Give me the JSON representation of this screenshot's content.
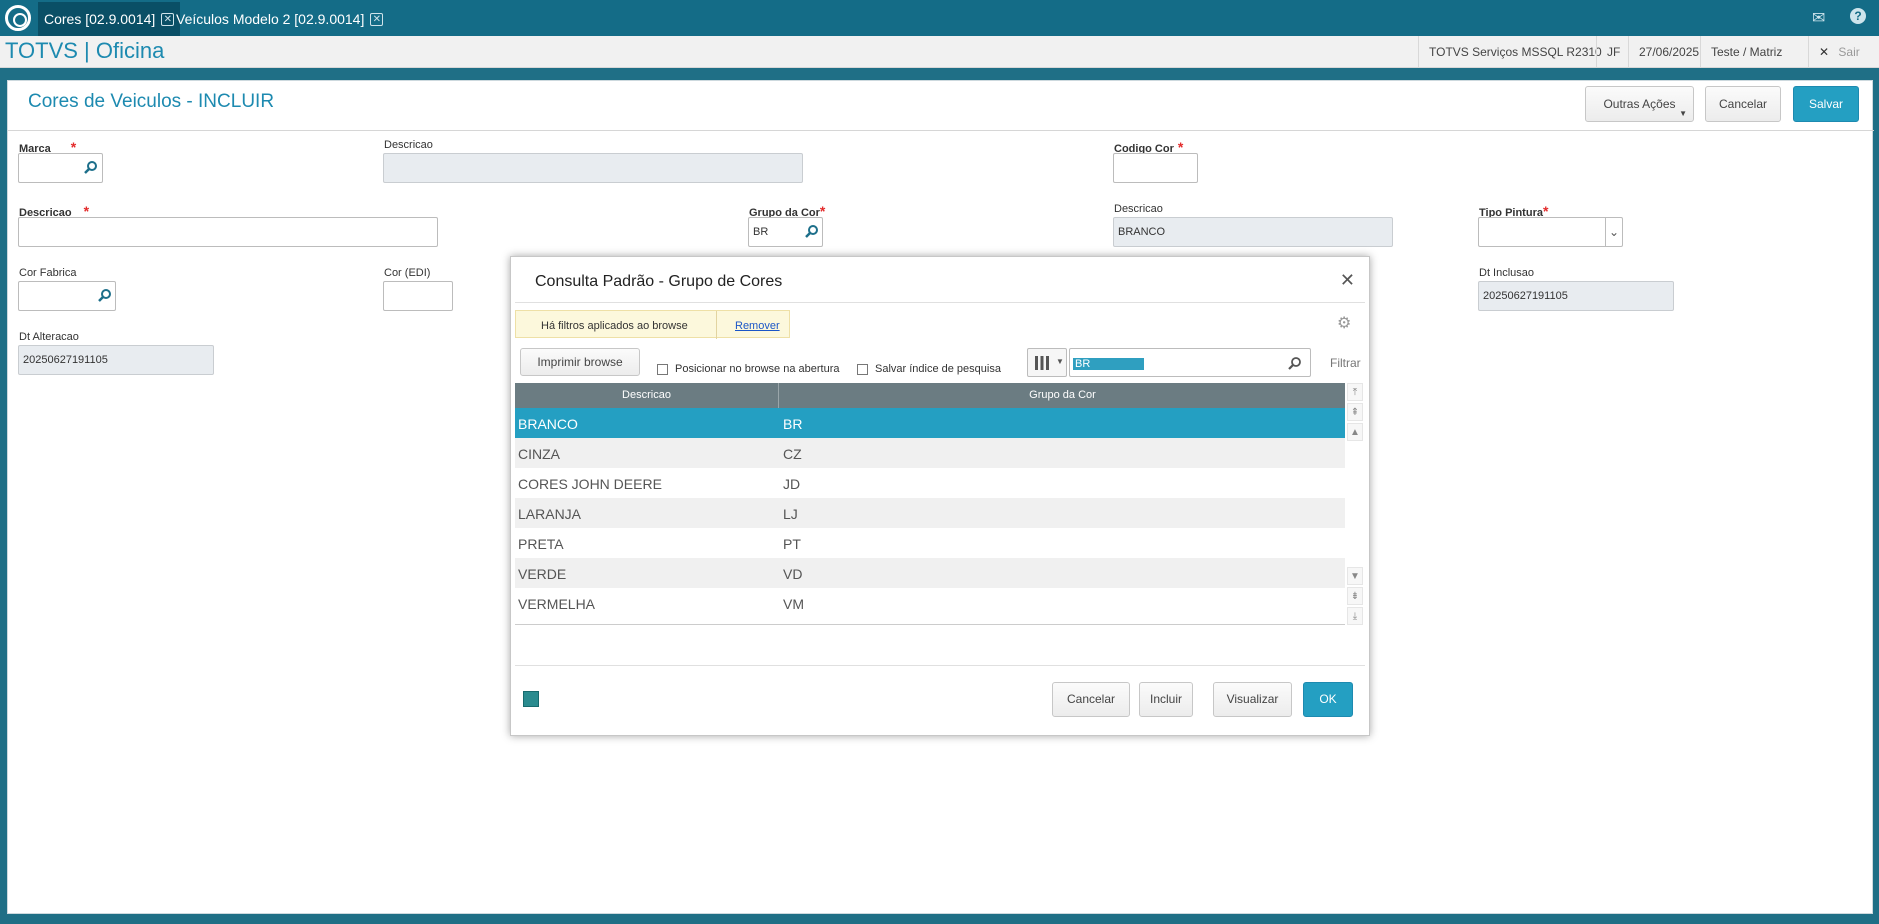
{
  "tabs": [
    {
      "label": "Cores [02.9.0014]"
    },
    {
      "label": "Veículos Modelo 2 [02.9.0014]"
    }
  ],
  "header": {
    "app_title": "TOTVS | Oficina",
    "server": "TOTVS Serviços MSSQL R2310",
    "user": "JF",
    "date": "27/06/2025",
    "branch": "Teste / Matriz",
    "sair": "Sair"
  },
  "form": {
    "title": "Cores de Veiculos - INCLUIR",
    "outras_acoes": "Outras Ações",
    "cancelar": "Cancelar",
    "salvar": "Salvar",
    "required_mark": "*",
    "fields": {
      "marca": {
        "label": "Marca",
        "value": ""
      },
      "marca_desc": {
        "label": "Descricao",
        "value": ""
      },
      "codigo_cor": {
        "label": "Codigo Cor",
        "value": ""
      },
      "descricao": {
        "label": "Descricao",
        "value": ""
      },
      "grupo_cor": {
        "label": "Grupo da Cor",
        "value": "BR"
      },
      "grupo_desc": {
        "label": "Descricao",
        "value": "BRANCO"
      },
      "tipo_pintura": {
        "label": "Tipo Pintura",
        "value": ""
      },
      "cor_fabrica": {
        "label": "Cor Fabrica",
        "value": ""
      },
      "cor_edi": {
        "label": "Cor (EDI)",
        "value": ""
      },
      "dt_inclusao": {
        "label": "Dt Inclusao",
        "value": "20250627191105"
      },
      "dt_alteracao": {
        "label": "Dt Alteracao",
        "value": "20250627191105"
      }
    }
  },
  "dialog": {
    "title": "Consulta Padrão - Grupo de Cores",
    "filter_notice": "Há filtros aplicados ao browse",
    "remover": "Remover",
    "imprimir": "Imprimir browse",
    "posicionar": "Posicionar no browse na abertura",
    "salvar_indice": "Salvar índice de pesquisa",
    "search_value": "BR",
    "filtrar": "Filtrar",
    "columns": [
      "Descricao",
      "Grupo da Cor"
    ],
    "rows": [
      {
        "descricao": "BRANCO",
        "grupo": "BR"
      },
      {
        "descricao": "CINZA",
        "grupo": "CZ"
      },
      {
        "descricao": "CORES JOHN DEERE",
        "grupo": "JD"
      },
      {
        "descricao": "LARANJA",
        "grupo": "LJ"
      },
      {
        "descricao": "PRETA",
        "grupo": "PT"
      },
      {
        "descricao": "VERDE",
        "grupo": "VD"
      },
      {
        "descricao": "VERMELHA",
        "grupo": "VM"
      }
    ],
    "buttons": {
      "cancelar": "Cancelar",
      "incluir": "Incluir",
      "visualizar": "Visualizar",
      "ok": "OK"
    }
  },
  "colors": {
    "accent": "#249fc2",
    "topbar": "#146c87",
    "required": "#e32b2b"
  },
  "icons": [
    "totvs-logo-icon",
    "close-icon",
    "mail-icon",
    "help-icon",
    "search-icon",
    "chevron-down-icon",
    "gear-icon",
    "columns-icon"
  ]
}
